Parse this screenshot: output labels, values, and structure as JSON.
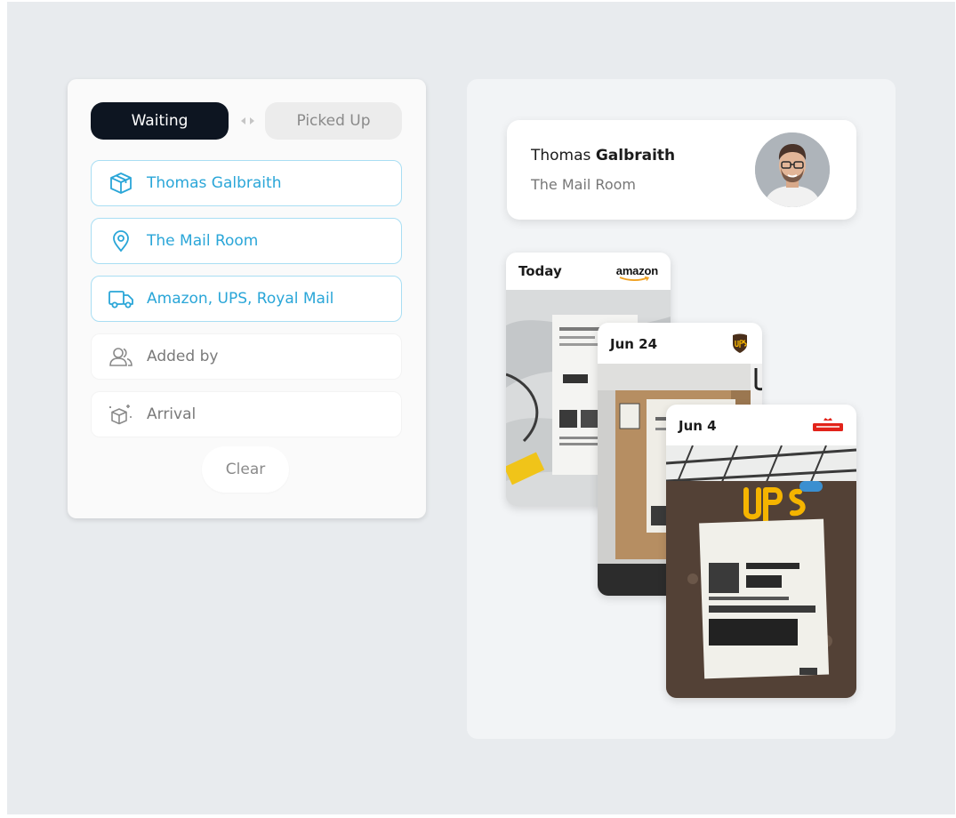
{
  "filters": {
    "tabs": [
      {
        "label": "Waiting",
        "active": true
      },
      {
        "label": "Picked Up",
        "active": false
      }
    ],
    "fields": [
      {
        "label": "Thomas Galbraith",
        "icon": "package-icon",
        "active": true
      },
      {
        "label": "The Mail Room",
        "icon": "location-pin-icon",
        "active": true
      },
      {
        "label": "Amazon, UPS, Royal Mail",
        "icon": "delivery-truck-icon",
        "active": true
      },
      {
        "label": "Added by",
        "icon": "users-icon",
        "active": false
      },
      {
        "label": "Arrival",
        "icon": "new-package-icon",
        "active": false
      }
    ],
    "clear_label": "Clear"
  },
  "recipient": {
    "first_name": "Thomas",
    "last_name": "Galbraith",
    "location": "The Mail Room"
  },
  "packages": [
    {
      "date": "Today",
      "carrier": "amazon",
      "carrier_logo": "amazon-logo"
    },
    {
      "date": "Jun 24",
      "carrier": "UPS",
      "carrier_logo": "ups-logo"
    },
    {
      "date": "Jun 4",
      "carrier": "Royal Mail",
      "carrier_logo": "royal-mail-logo"
    }
  ],
  "colors": {
    "accent": "#2aa6d8",
    "active_tab": "#0d1521",
    "background": "#e8ebee"
  }
}
